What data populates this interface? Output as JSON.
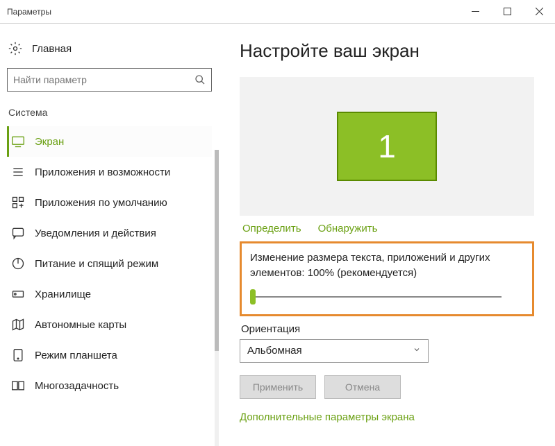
{
  "window": {
    "title": "Параметры"
  },
  "sidebar": {
    "home": "Главная",
    "search_placeholder": "Найти параметр",
    "category": "Система",
    "items": [
      {
        "label": "Экран"
      },
      {
        "label": "Приложения и возможности"
      },
      {
        "label": "Приложения по умолчанию"
      },
      {
        "label": "Уведомления и действия"
      },
      {
        "label": "Питание и спящий режим"
      },
      {
        "label": "Хранилище"
      },
      {
        "label": "Автономные карты"
      },
      {
        "label": "Режим планшета"
      },
      {
        "label": "Многозадачность"
      }
    ]
  },
  "main": {
    "title": "Настройте ваш экран",
    "monitor_number": "1",
    "identify": "Определить",
    "detect": "Обнаружить",
    "scale_text": "Изменение размера текста, приложений и других элементов: 100% (рекомендуется)",
    "orientation_label": "Ориентация",
    "orientation_value": "Альбомная",
    "apply": "Применить",
    "cancel": "Отмена",
    "extra_link": "Дополнительные параметры экрана"
  }
}
